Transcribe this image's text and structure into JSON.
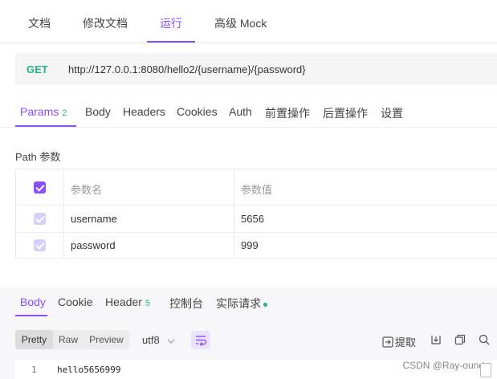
{
  "top_tabs": [
    {
      "label": "文档"
    },
    {
      "label": "修改文档"
    },
    {
      "label": "运行"
    },
    {
      "label": "高级 Mock"
    }
  ],
  "request": {
    "method": "GET",
    "url": "http://127.0.0.1:8080/hello2/{username}/{password}"
  },
  "request_tabs": {
    "params_label": "Params",
    "params_count": "2",
    "items": [
      "Body",
      "Headers",
      "Cookies",
      "Auth",
      "前置操作",
      "后置操作",
      "设置"
    ]
  },
  "path_params": {
    "section_label": "Path 参数",
    "headers": {
      "name": "参数名",
      "value": "参数值"
    },
    "rows": [
      {
        "name": "username",
        "value": "5656"
      },
      {
        "name": "password",
        "value": "999"
      }
    ]
  },
  "response_tabs": {
    "body": "Body",
    "cookie": "Cookie",
    "header": "Header",
    "header_count": "5",
    "console": "控制台",
    "actual_request": "实际请求"
  },
  "viewer": {
    "modes": [
      "Pretty",
      "Raw",
      "Preview"
    ],
    "encoding": "utf8",
    "extract_label": "提取"
  },
  "code": {
    "line_number": "1",
    "content": "hello5656999"
  },
  "watermark": "CSDN @Ray-ound",
  "colors": {
    "accent": "#8a4dff",
    "get_method": "#26b47f"
  }
}
